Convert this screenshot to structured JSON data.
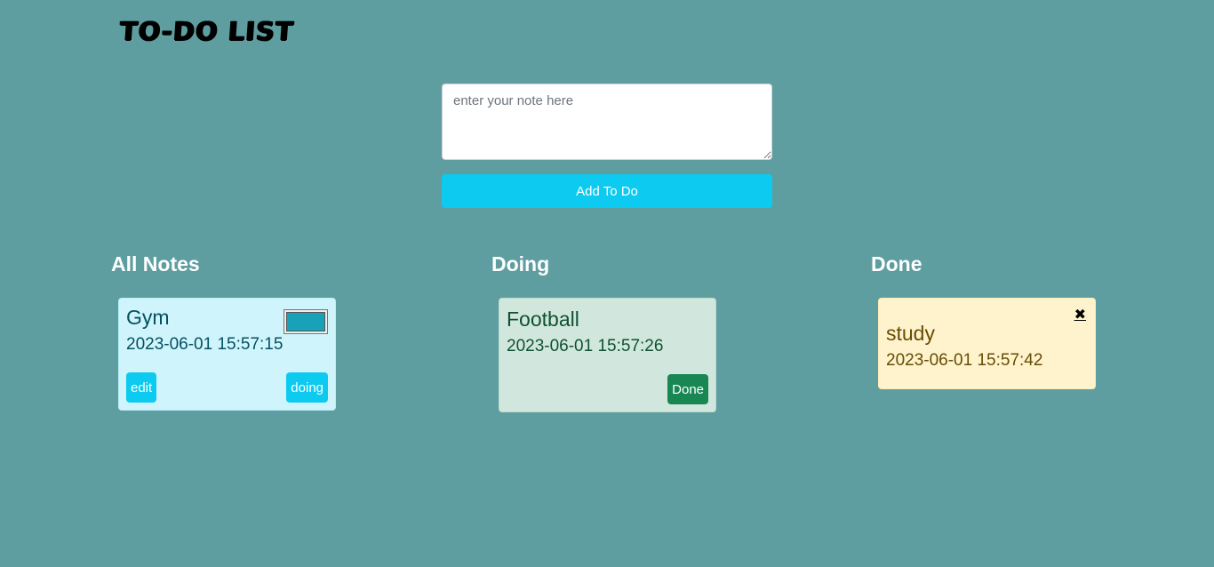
{
  "app": {
    "logo": "TO-DO LIST"
  },
  "composer": {
    "placeholder": "enter your note here",
    "add_label": "Add To Do"
  },
  "columns": {
    "all": "All Notes",
    "doing": "Doing",
    "done": "Done"
  },
  "cards": {
    "all": [
      {
        "title": "Gym",
        "date": "2023-06-01 15:57:15",
        "edit": "edit",
        "doing": "doing",
        "color": "#17a2b8"
      }
    ],
    "doing": [
      {
        "title": "Football",
        "date": "2023-06-01 15:57:26",
        "done": "Done"
      }
    ],
    "done": [
      {
        "title": "study",
        "date": "2023-06-01 15:57:42",
        "close": "✖"
      }
    ]
  },
  "colors": {
    "background": "#5f9ea0",
    "accent": "#0dcaf0",
    "success": "#198754"
  }
}
